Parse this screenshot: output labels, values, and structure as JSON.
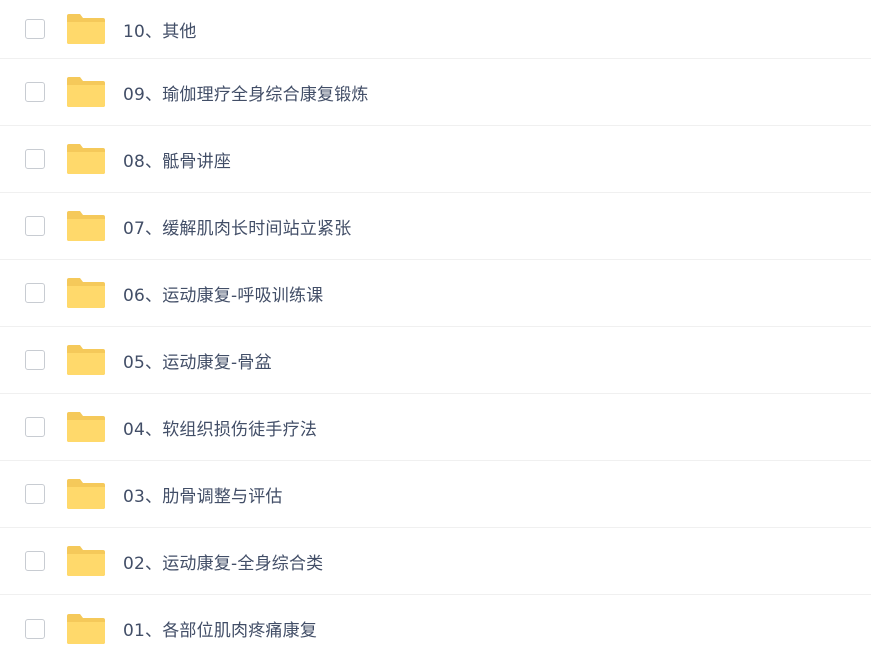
{
  "file_list": {
    "items": [
      {
        "name": "10、其他",
        "icon": "folder-icon"
      },
      {
        "name": "09、瑜伽理疗全身综合康复锻炼",
        "icon": "folder-icon"
      },
      {
        "name": "08、骶骨讲座",
        "icon": "folder-icon"
      },
      {
        "name": "07、缓解肌肉长时间站立紧张",
        "icon": "folder-icon"
      },
      {
        "name": "06、运动康复-呼吸训练课",
        "icon": "folder-icon"
      },
      {
        "name": "05、运动康复-骨盆",
        "icon": "folder-icon"
      },
      {
        "name": "04、软组织损伤徒手疗法",
        "icon": "folder-icon"
      },
      {
        "name": "03、肋骨调整与评估",
        "icon": "folder-icon"
      },
      {
        "name": "02、运动康复-全身综合类",
        "icon": "folder-icon"
      },
      {
        "name": "01、各部位肌肉疼痛康复",
        "icon": "folder-icon"
      }
    ]
  },
  "colors": {
    "folder_back": "#f5c95a",
    "folder_front": "#ffd96b",
    "text": "#424e67",
    "divider": "#f0f0f0",
    "checkbox_border": "#c8ccd2"
  }
}
